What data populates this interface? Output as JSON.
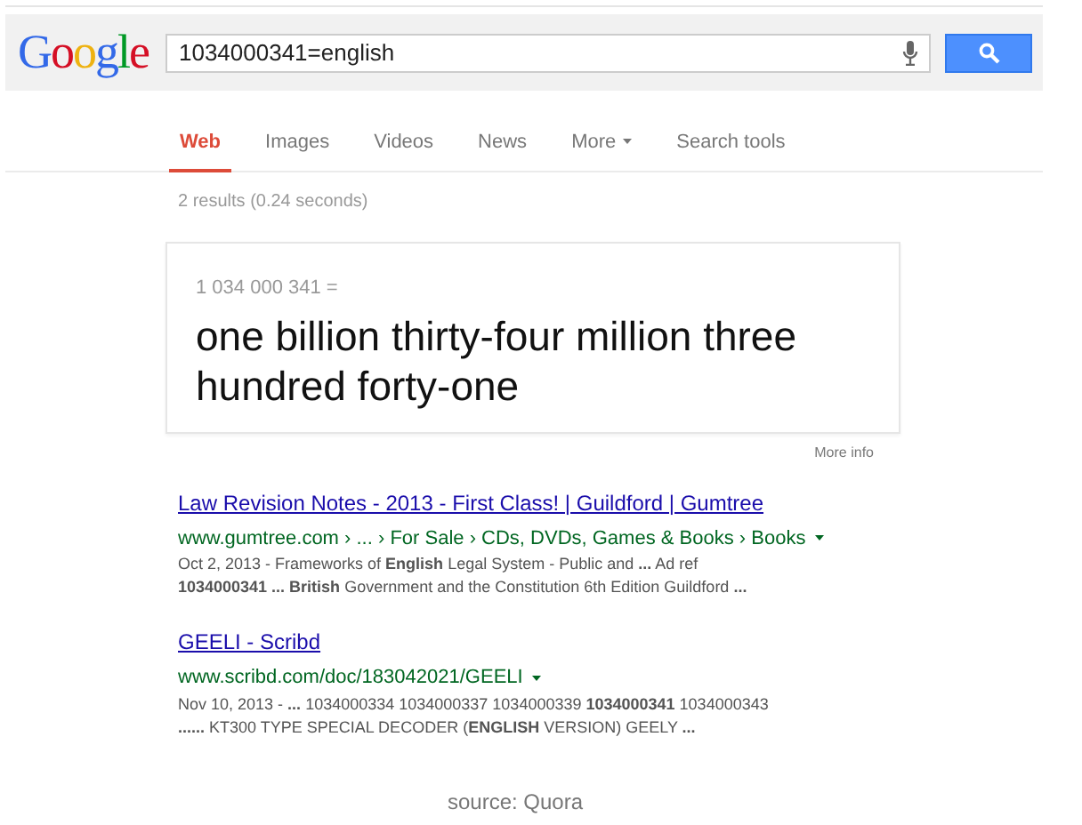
{
  "logo": "Google",
  "search": {
    "value": "1034000341=english"
  },
  "tabs": [
    {
      "label": "Web",
      "selected": true,
      "dropdown": false
    },
    {
      "label": "Images",
      "selected": false,
      "dropdown": false
    },
    {
      "label": "Videos",
      "selected": false,
      "dropdown": false
    },
    {
      "label": "News",
      "selected": false,
      "dropdown": false
    },
    {
      "label": "More",
      "selected": false,
      "dropdown": true
    },
    {
      "label": "Search tools",
      "selected": false,
      "dropdown": false
    }
  ],
  "result_stats": "2 results (0.24 seconds)",
  "answer_card": {
    "expression": "1 034 000 341 =",
    "answer": "one billion thirty-four million three hundred forty-one",
    "more_info": "More info"
  },
  "results": [
    {
      "title": "Law Revision Notes - 2013 - First Class! | Guildford | Gumtree",
      "url": "www.gumtree.com › ... › For Sale › CDs, DVDs, Games & Books › Books",
      "snippet": [
        "Oct 2, 2013 - Frameworks of **English** Legal System - Public and **...** Ad ref",
        "**1034000341 ... British** Government and the Constitution 6th Edition Guildford **...**"
      ]
    },
    {
      "title": "GEELI - Scribd",
      "url": "www.scribd.com/doc/183042021/GEELI",
      "snippet": [
        "Nov 10, 2013 - **...** 1034000334 1034000337 1034000339 **1034000341** 1034000343",
        "**......** KT300 TYPE SPECIAL DECODER (**ENGLISH** VERSION) GEELY **...**"
      ]
    }
  ],
  "caption": "source: Quora"
}
